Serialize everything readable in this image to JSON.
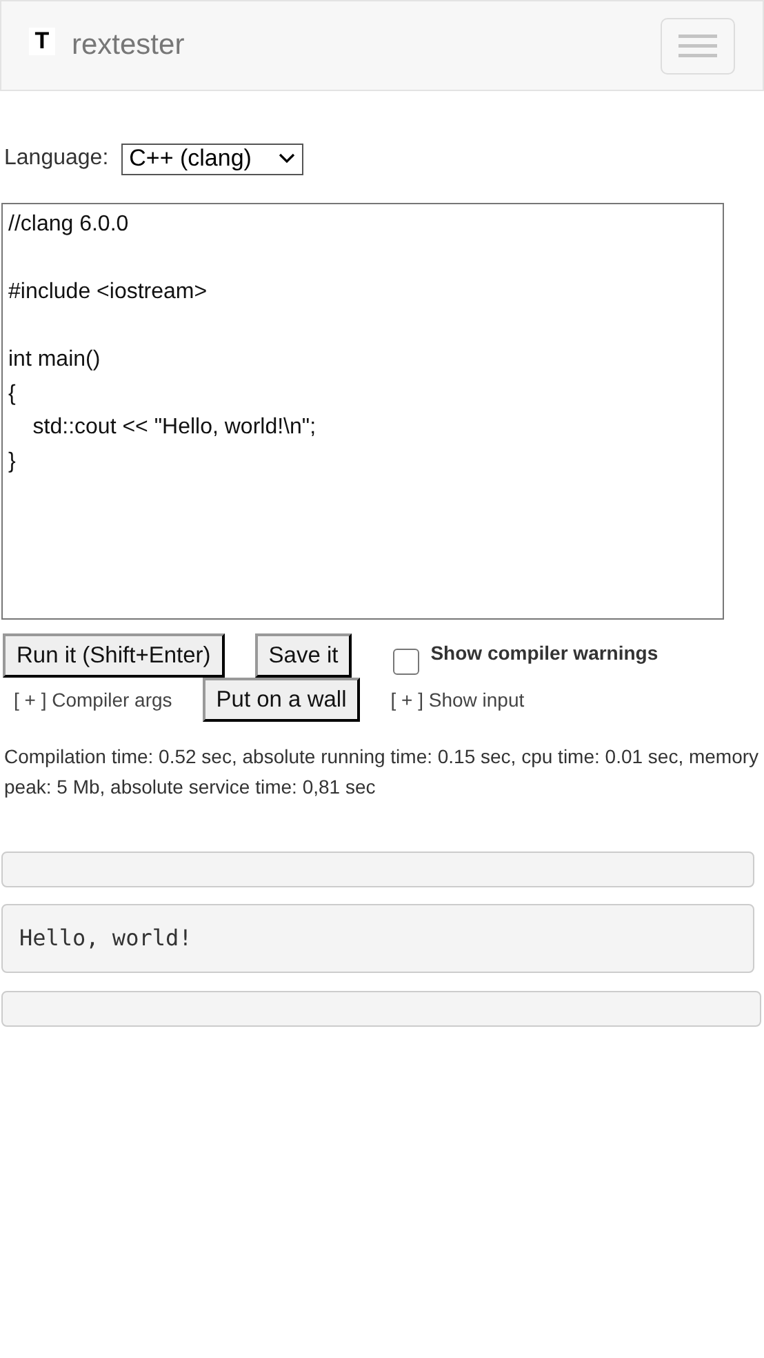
{
  "navbar": {
    "logo": "T",
    "brand": "rextester"
  },
  "language": {
    "label": "Language:",
    "value": "C++ (clang)"
  },
  "editor": {
    "code": "//clang 6.0.0\n\n#include <iostream>\n\nint main()\n{\n    std::cout << \"Hello, world!\\n\";\n}"
  },
  "buttons": {
    "run": "Run it (Shift+Enter)",
    "save": "Save it",
    "wall": "Put on a wall"
  },
  "warnings": {
    "label": "Show compiler warnings",
    "checked": false
  },
  "toggles": {
    "compiler_args": "[ + ] Compiler args",
    "show_input": "[ + ] Show input"
  },
  "stats": "Compilation time: 0.52 sec, absolute running time: 0.15 sec, cpu time: 0.01 sec, memory peak: 5 Mb, absolute service time: 0,81 sec",
  "panels": [
    {
      "kind": "empty"
    },
    {
      "kind": "output",
      "text": "Hello, world!"
    },
    {
      "kind": "empty"
    }
  ]
}
